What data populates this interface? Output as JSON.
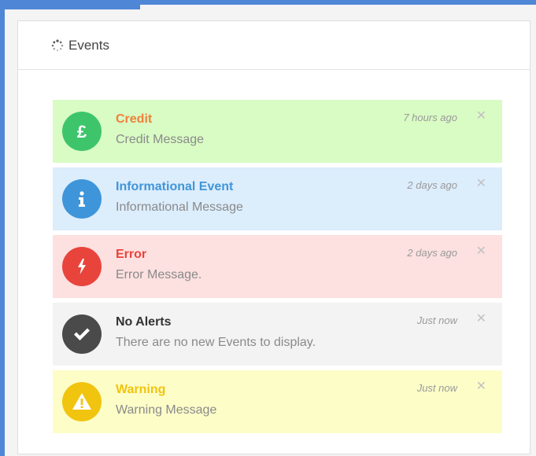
{
  "panel": {
    "title": "Events"
  },
  "colors": {
    "frame_border": "#4f86d6",
    "credit_bg": "#d9fbc4",
    "credit_icon": "#3ec56c",
    "credit_title": "#f0803c",
    "info_bg": "#dcedfc",
    "info_icon": "#3f95d9",
    "info_title": "#3f95d9",
    "error_bg": "#fde0e0",
    "error_icon": "#e8443c",
    "error_title": "#e8443c",
    "none_bg": "#f3f3f3",
    "none_icon": "#4a4a4a",
    "none_title": "#333333",
    "warning_bg": "#fdfdc8",
    "warning_icon": "#f1c40f",
    "warning_title": "#f1c40f"
  },
  "events": [
    {
      "type": "credit",
      "icon": "pound-icon",
      "title": "Credit",
      "message": "Credit Message",
      "time": "7 hours ago",
      "close": "✕"
    },
    {
      "type": "info",
      "icon": "info-icon",
      "title": "Informational Event",
      "message": "Informational Message",
      "time": "2 days ago",
      "close": "✕"
    },
    {
      "type": "error",
      "icon": "lightning-bolt-icon",
      "title": "Error",
      "message": "Error Message.",
      "time": "2 days ago",
      "close": "✕"
    },
    {
      "type": "none",
      "icon": "checkmark-icon",
      "title": "No Alerts",
      "message": "There are no new Events to display.",
      "time": "Just now",
      "close": "✕"
    },
    {
      "type": "warning",
      "icon": "warning-triangle-icon",
      "title": "Warning",
      "message": "Warning Message",
      "time": "Just now",
      "close": "✕"
    }
  ]
}
